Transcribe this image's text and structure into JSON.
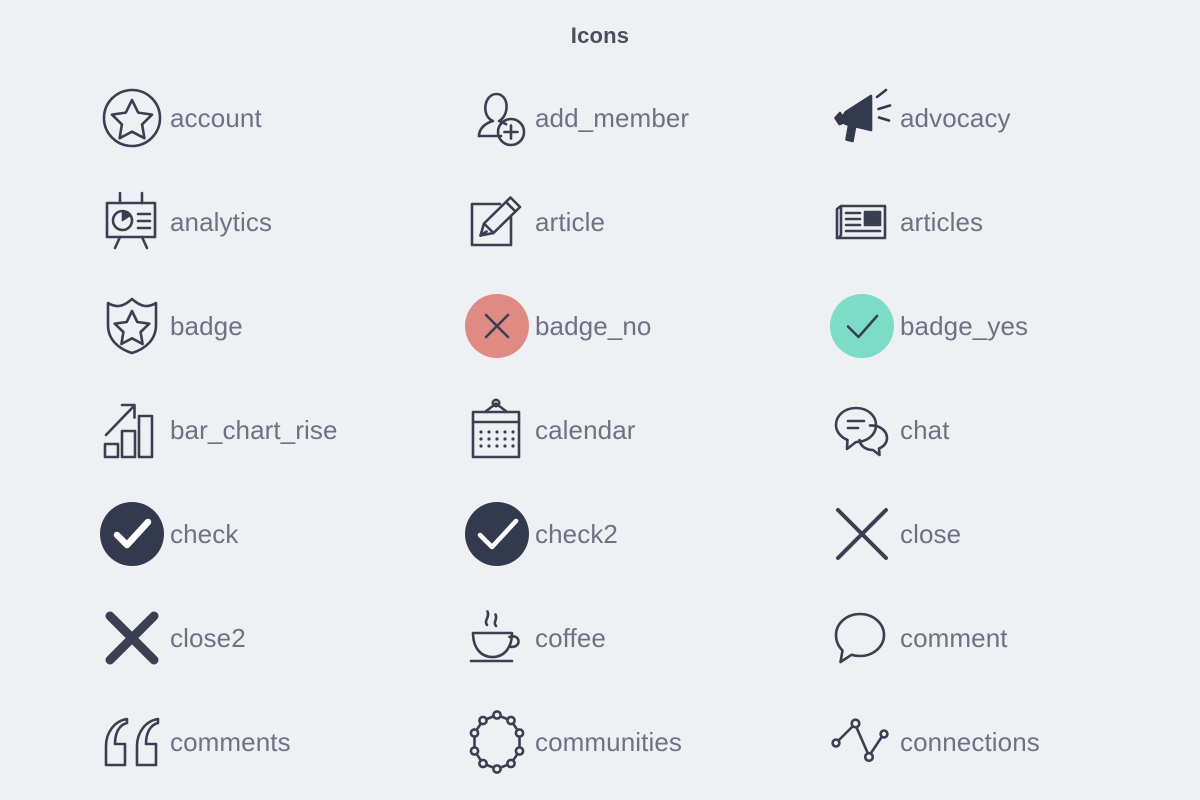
{
  "header": {
    "title": "Icons"
  },
  "colors": {
    "background": "#eef0f3",
    "title_text": "#4a5060",
    "label_text": "#6d7385",
    "icon_stroke": "#3a4052",
    "badge_no_fill": "#e08a84",
    "badge_yes_fill": "#7cdcc6",
    "solid_dark": "#343a4d",
    "glyph_light": "#ffffff"
  },
  "icons": [
    {
      "id": "account",
      "label": "account",
      "glyph": "star-in-circle-icon"
    },
    {
      "id": "add_member",
      "label": "add_member",
      "glyph": "person-plus-icon"
    },
    {
      "id": "advocacy",
      "label": "advocacy",
      "glyph": "megaphone-icon"
    },
    {
      "id": "analytics",
      "label": "analytics",
      "glyph": "presentation-chart-icon"
    },
    {
      "id": "article",
      "label": "article",
      "glyph": "square-pencil-icon"
    },
    {
      "id": "articles",
      "label": "articles",
      "glyph": "newspaper-icon"
    },
    {
      "id": "badge",
      "label": "badge",
      "glyph": "shield-star-icon"
    },
    {
      "id": "badge_no",
      "label": "badge_no",
      "glyph": "circle-x-red-icon"
    },
    {
      "id": "badge_yes",
      "label": "badge_yes",
      "glyph": "circle-check-teal-icon"
    },
    {
      "id": "bar_chart_rise",
      "label": "bar_chart_rise",
      "glyph": "bar-chart-arrow-up-icon"
    },
    {
      "id": "calendar",
      "label": "calendar",
      "glyph": "calendar-icon"
    },
    {
      "id": "chat",
      "label": "chat",
      "glyph": "two-speech-bubbles-icon"
    },
    {
      "id": "check",
      "label": "check",
      "glyph": "filled-circle-check-icon"
    },
    {
      "id": "check2",
      "label": "check2",
      "glyph": "filled-circle-check-thin-icon"
    },
    {
      "id": "close",
      "label": "close",
      "glyph": "x-thin-icon"
    },
    {
      "id": "close2",
      "label": "close2",
      "glyph": "x-thick-icon"
    },
    {
      "id": "coffee",
      "label": "coffee",
      "glyph": "coffee-cup-icon"
    },
    {
      "id": "comment",
      "label": "comment",
      "glyph": "speech-bubble-icon"
    },
    {
      "id": "comments",
      "label": "comments",
      "glyph": "quotation-marks-icon"
    },
    {
      "id": "communities",
      "label": "communities",
      "glyph": "node-ring-icon"
    },
    {
      "id": "connections",
      "label": "connections",
      "glyph": "zigzag-nodes-icon"
    }
  ]
}
